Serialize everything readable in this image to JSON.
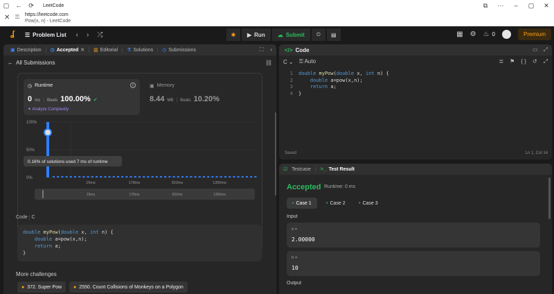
{
  "browser": {
    "tab_title": "LeetCode",
    "url": "https://leetcode.com",
    "page_title": "Pow(x, n) - LeetCode"
  },
  "topnav": {
    "problem_list": "Problem List",
    "run": "Run",
    "submit": "Submit",
    "streak_count": "0",
    "premium": "Premium"
  },
  "left": {
    "tabs": [
      {
        "label": "Description"
      },
      {
        "label": "Accepted"
      },
      {
        "label": "Editorial"
      },
      {
        "label": "Solutions"
      },
      {
        "label": "Submissions"
      }
    ],
    "back_label": "All Submissions",
    "runtime": {
      "title": "Runtime",
      "value": "0",
      "unit": "ms",
      "beats_label": "Beats",
      "beats_value": "100.00%",
      "analyze": "Analyze Complexity"
    },
    "memory": {
      "title": "Memory",
      "value": "8.44",
      "unit": "MB",
      "beats_label": "Beats",
      "beats_value": "10.20%"
    },
    "code_label": "Code",
    "code_lang": "C",
    "code_lines": [
      "double myPow(double x, int n) {",
      "    double a=pow(x,n);",
      "    return a;",
      "}"
    ],
    "more_challenges": "More challenges",
    "challenges": [
      "372. Super Pow",
      "2550. Count Collisions of Monkeys on a Polygon"
    ]
  },
  "chart_data": {
    "type": "bar",
    "title": "",
    "ylabel": "",
    "y_ticks": [
      "100%",
      "50%",
      "0%"
    ],
    "ylim": [
      0,
      100
    ],
    "x_ticks": [
      "15ms",
      "178ms",
      "922ms",
      "1350ms"
    ],
    "mini_x_ticks": [
      "15ms",
      "178ms",
      "922ms",
      "1350ms"
    ],
    "highlight_bar_value": 100,
    "tooltip": "0.16% of solutions used 7 ms of runtime",
    "accent": "#2e7fff"
  },
  "code_panel": {
    "title": "Code",
    "lang": "C",
    "mode": "Auto",
    "line_numbers": [
      "1",
      "2",
      "3",
      "4"
    ],
    "lines": [
      "double myPow(double x, int n) {",
      "    double a=pow(x,n);",
      "    return a;",
      "}"
    ],
    "saved": "Saved",
    "cursor": "Ln 1, Col 14"
  },
  "test_panel": {
    "tab_testcase": "Testcase",
    "tab_result": "Test Result",
    "status": "Accepted",
    "runtime": "Runtime: 0 ms",
    "cases": [
      "Case 1",
      "Case 2",
      "Case 3"
    ],
    "input_label": "Input",
    "inputs": [
      {
        "name": "x =",
        "value": "2.00000"
      },
      {
        "name": "n =",
        "value": "10"
      }
    ],
    "output_label": "Output"
  }
}
